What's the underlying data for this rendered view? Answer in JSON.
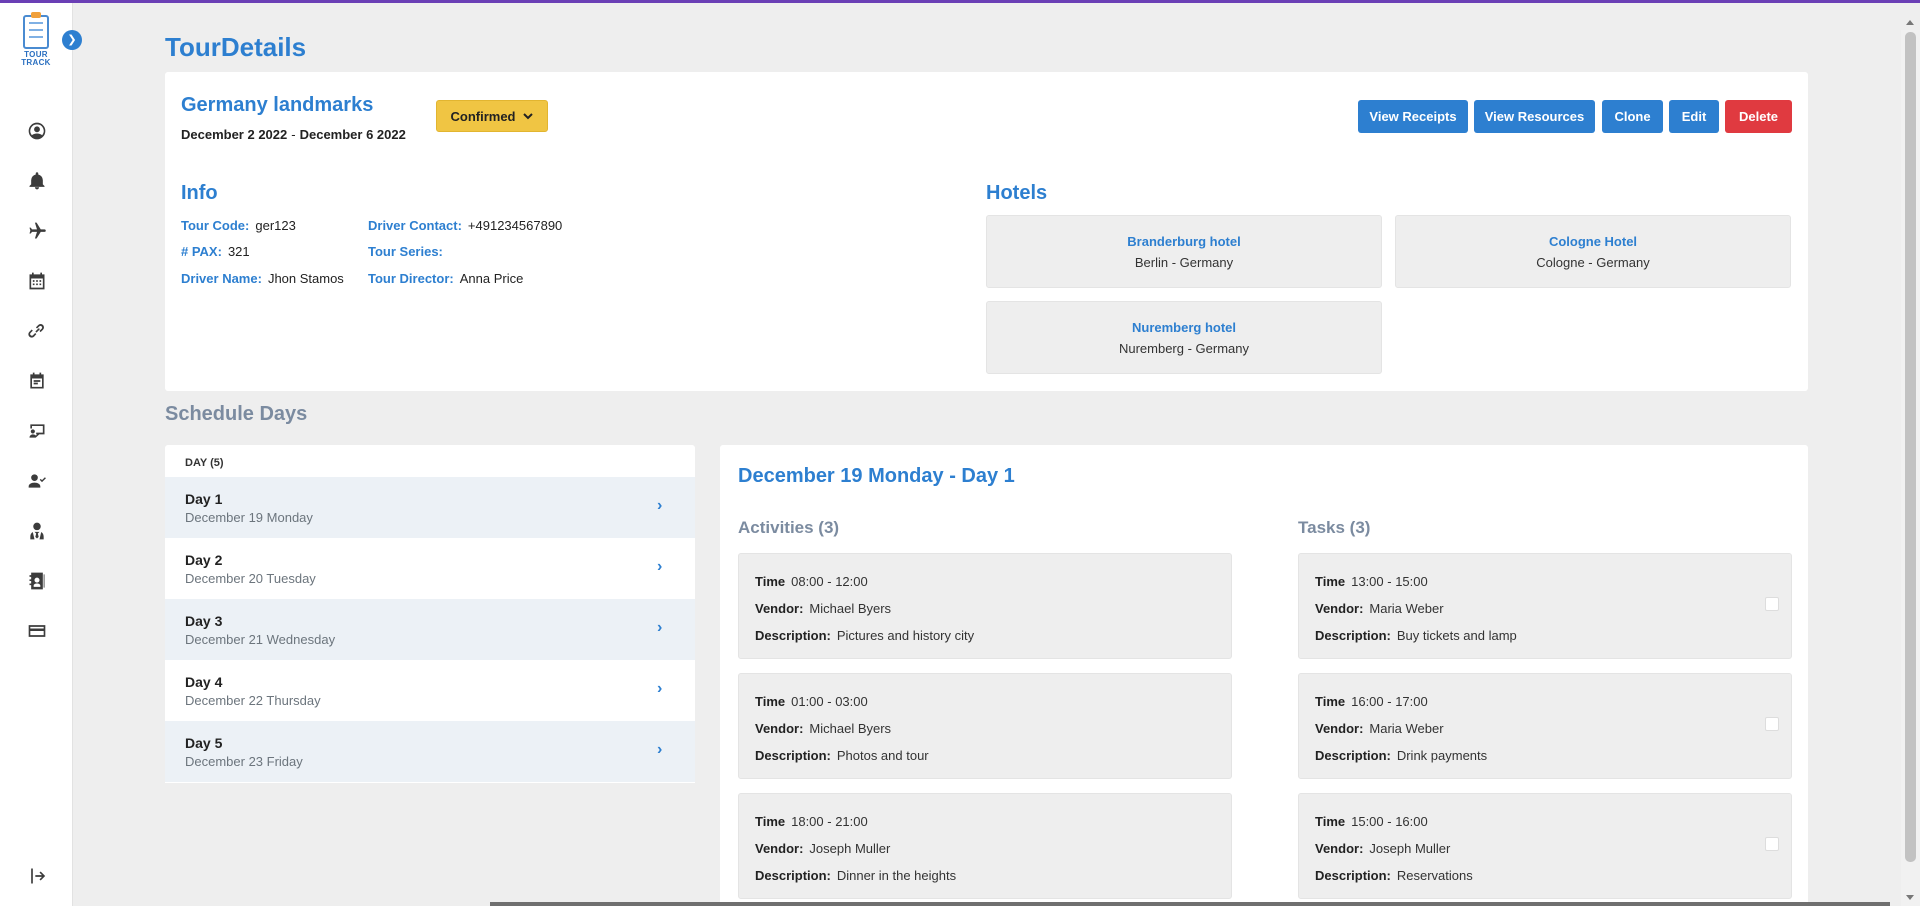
{
  "app": {
    "logo_text": "TOUR TRACK",
    "accent": "#2d7fd0",
    "danger": "#e03a40",
    "warning": "#f0c543"
  },
  "sidebar": {
    "expand_icon": "chevron-right-icon",
    "items": [
      {
        "name": "profile-icon"
      },
      {
        "name": "bell-icon"
      },
      {
        "name": "plane-icon"
      },
      {
        "name": "calendar-icon"
      },
      {
        "name": "link-icon"
      },
      {
        "name": "schedule-icon"
      },
      {
        "name": "presentation-icon"
      },
      {
        "name": "user-check-icon"
      },
      {
        "name": "user-tie-icon"
      },
      {
        "name": "address-book-icon"
      },
      {
        "name": "credit-card-icon"
      }
    ],
    "logout_icon": "logout-icon"
  },
  "page": {
    "title": "TourDetails"
  },
  "tour": {
    "name": "Germany landmarks",
    "start_date": "December 2 2022",
    "date_sep": "-",
    "end_date": "December 6 2022",
    "status": "Confirmed"
  },
  "actions": {
    "view_receipts": "View Receipts",
    "view_resources": "View Resources",
    "clone": "Clone",
    "edit": "Edit",
    "delete": "Delete"
  },
  "info": {
    "title": "Info",
    "tour_code_label": "Tour Code:",
    "tour_code": "ger123",
    "pax_label": "# PAX:",
    "pax": "321",
    "driver_name_label": "Driver Name:",
    "driver_name": "Jhon Stamos",
    "driver_contact_label": "Driver Contact:",
    "driver_contact": "+491234567890",
    "tour_series_label": "Tour Series:",
    "tour_series": "",
    "tour_director_label": "Tour Director:",
    "tour_director": "Anna Price"
  },
  "hotels": {
    "title": "Hotels",
    "items": [
      {
        "name": "Branderburg hotel",
        "location": "Berlin - Germany"
      },
      {
        "name": "Cologne Hotel",
        "location": "Cologne - Germany"
      },
      {
        "name": "Nuremberg hotel",
        "location": "Nuremberg - Germany"
      }
    ]
  },
  "schedule": {
    "title": "Schedule Days",
    "days_header": "DAY (5)",
    "days": [
      {
        "label": "Day 1",
        "date": "December 19 Monday"
      },
      {
        "label": "Day 2",
        "date": "December 20 Tuesday"
      },
      {
        "label": "Day 3",
        "date": "December 21 Wednesday"
      },
      {
        "label": "Day 4",
        "date": "December 22 Thursday"
      },
      {
        "label": "Day 5",
        "date": "December 23 Friday"
      }
    ],
    "selected_title": "December 19 Monday - Day 1",
    "activities_title": "Activities (3)",
    "tasks_title": "Tasks (3)",
    "time_label": "Time",
    "vendor_label": "Vendor:",
    "description_label": "Description:",
    "activities": [
      {
        "time": "08:00 - 12:00",
        "vendor": "Michael Byers",
        "description": "Pictures and history city"
      },
      {
        "time": "01:00 - 03:00",
        "vendor": "Michael Byers",
        "description": "Photos and tour"
      },
      {
        "time": "18:00 - 21:00",
        "vendor": "Joseph Muller",
        "description": "Dinner in the heights"
      }
    ],
    "tasks": [
      {
        "time": "13:00 - 15:00",
        "vendor": "Maria Weber",
        "description": "Buy tickets and lamp",
        "done": false
      },
      {
        "time": "16:00 - 17:00",
        "vendor": "Maria Weber",
        "description": "Drink payments",
        "done": false
      },
      {
        "time": "15:00 - 16:00",
        "vendor": "Joseph Muller",
        "description": "Reservations",
        "done": false
      }
    ]
  }
}
